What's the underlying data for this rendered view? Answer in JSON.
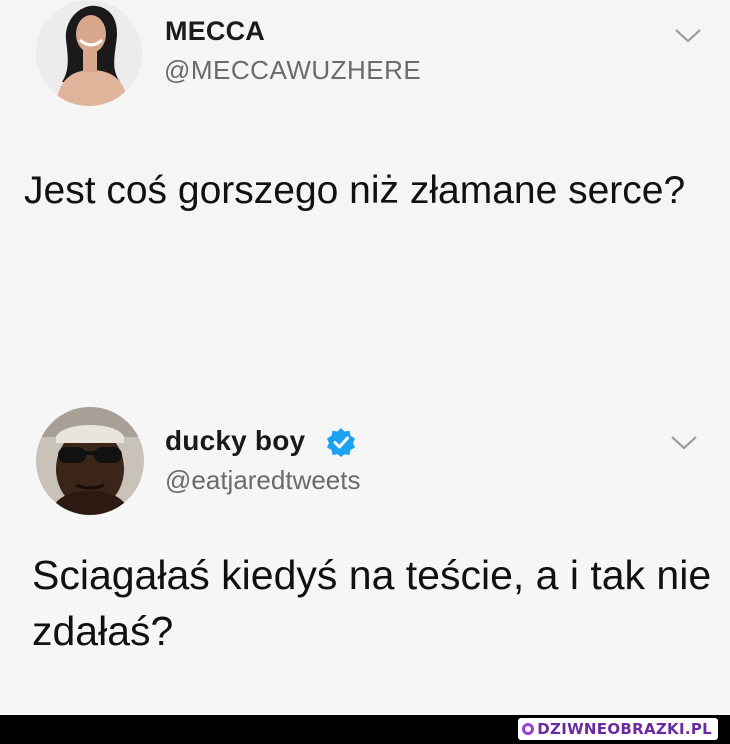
{
  "tweets": [
    {
      "display_name": "MECCA",
      "handle": "@MECCAWUZHERE",
      "verified": false,
      "text": "Jest coś gorszego niż złamane serce?"
    },
    {
      "display_name": "ducky boy",
      "handle": "@eatjaredtweets",
      "verified": true,
      "text": "Sciagałaś kiedyś na teście, a i tak nie zdałaś?"
    }
  ],
  "footer": {
    "site": "DZIWNEOBRAZKI.PL"
  },
  "colors": {
    "verified_badge": "#1da1f2",
    "footer_brand": "#6a2aa0"
  },
  "icons": [
    "chevron-down-icon",
    "verified-badge-icon",
    "site-logo-icon"
  ]
}
